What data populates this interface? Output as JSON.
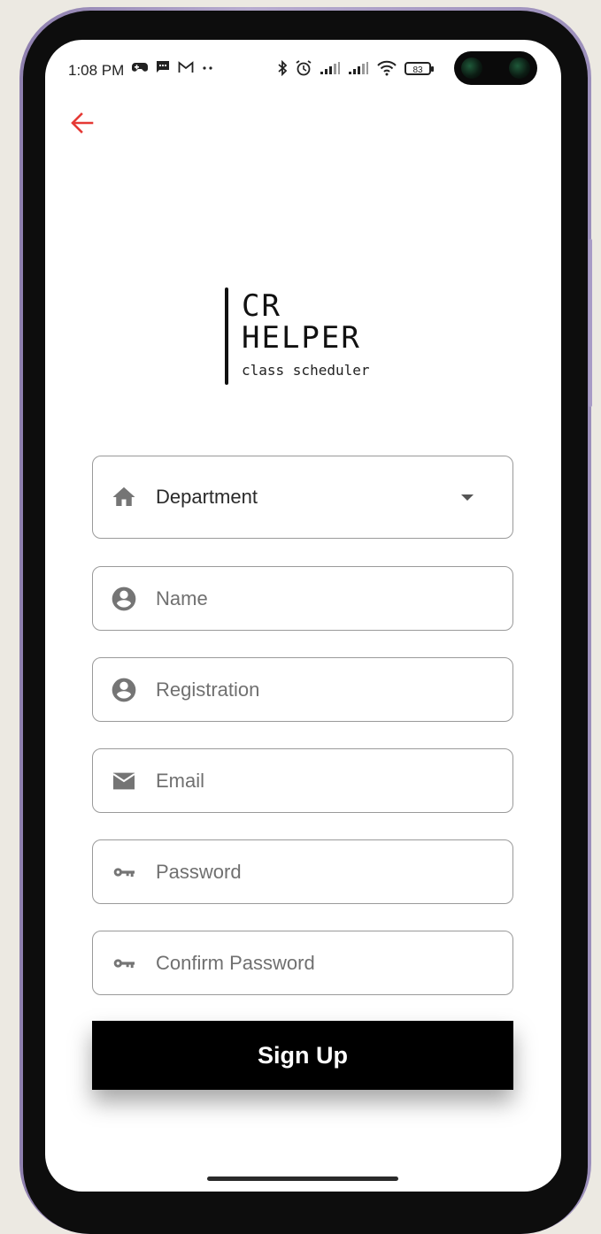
{
  "status_bar": {
    "time": "1:08 PM",
    "left_icons": [
      "game-controller-icon",
      "message-icon",
      "gmail-icon",
      "more-dots-icon"
    ],
    "right_icons": [
      "bluetooth-icon",
      "alarm-icon",
      "signal-icon",
      "signal-icon",
      "wifi-icon"
    ],
    "battery_level": "83"
  },
  "logo": {
    "line1": "CR",
    "line2": "HELPER",
    "tagline": "class scheduler"
  },
  "form": {
    "department": {
      "value": "Department",
      "icon": "home-icon"
    },
    "name": {
      "placeholder": "Name",
      "icon": "account-circle-icon"
    },
    "registration": {
      "placeholder": "Registration",
      "icon": "account-circle-icon"
    },
    "email": {
      "placeholder": "Email",
      "icon": "mail-icon"
    },
    "password": {
      "placeholder": "Password",
      "icon": "key-icon"
    },
    "confirm_password": {
      "placeholder": "Confirm Password",
      "icon": "key-icon"
    }
  },
  "signup_button": {
    "label": "Sign Up"
  },
  "colors": {
    "back_arrow": "#e53935",
    "button_bg": "#000000",
    "icon_gray": "#757575"
  }
}
